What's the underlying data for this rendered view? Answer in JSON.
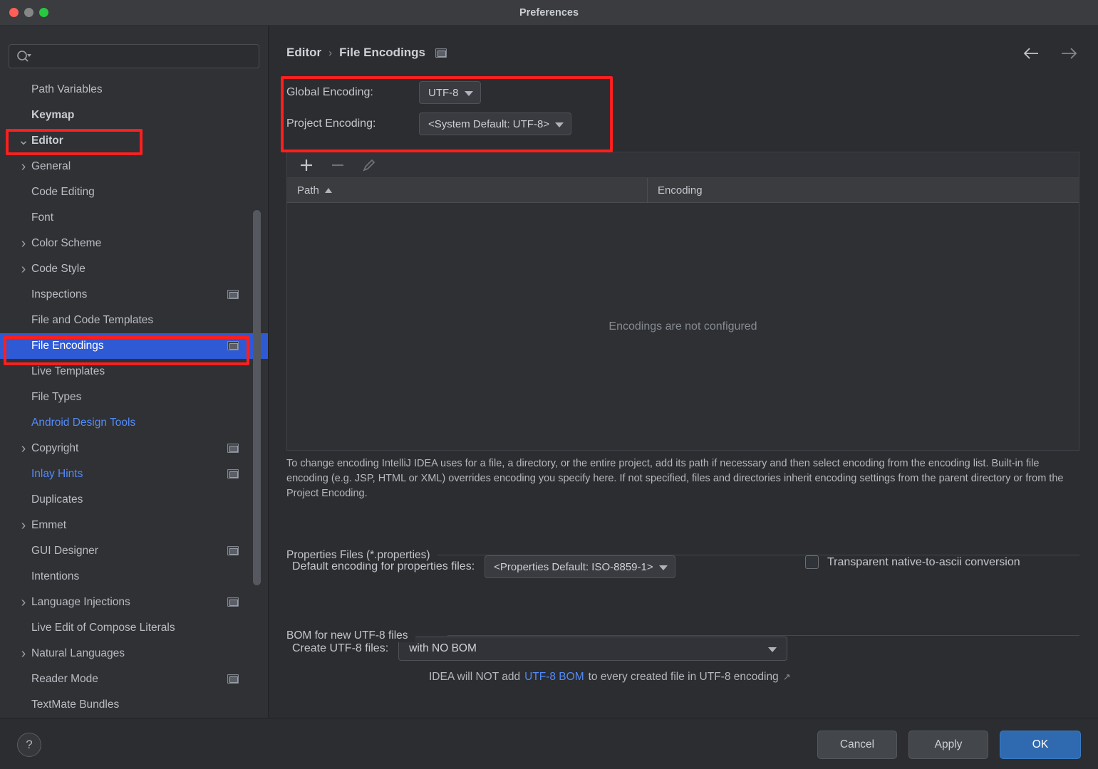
{
  "window": {
    "title": "Preferences",
    "traffic_lights": [
      "close",
      "minimize",
      "zoom"
    ]
  },
  "sidebar": {
    "search": {
      "value": "",
      "placeholder": "",
      "icon": "search-icon"
    },
    "items": [
      {
        "label": "Path Variables",
        "depth": 1,
        "chevron": "",
        "bold": false,
        "blue": false,
        "badge": false,
        "selected": false
      },
      {
        "label": "Keymap",
        "depth": 0,
        "chevron": "",
        "bold": true,
        "blue": false,
        "badge": false,
        "selected": false
      },
      {
        "label": "Editor",
        "depth": 0,
        "chevron": "v",
        "bold": true,
        "blue": false,
        "badge": false,
        "selected": false
      },
      {
        "label": "General",
        "depth": 1,
        "chevron": ">",
        "bold": false,
        "blue": false,
        "badge": false,
        "selected": false
      },
      {
        "label": "Code Editing",
        "depth": 1,
        "chevron": "",
        "bold": false,
        "blue": false,
        "badge": false,
        "selected": false
      },
      {
        "label": "Font",
        "depth": 1,
        "chevron": "",
        "bold": false,
        "blue": false,
        "badge": false,
        "selected": false
      },
      {
        "label": "Color Scheme",
        "depth": 1,
        "chevron": ">",
        "bold": false,
        "blue": false,
        "badge": false,
        "selected": false
      },
      {
        "label": "Code Style",
        "depth": 1,
        "chevron": ">",
        "bold": false,
        "blue": false,
        "badge": false,
        "selected": false
      },
      {
        "label": "Inspections",
        "depth": 1,
        "chevron": "",
        "bold": false,
        "blue": false,
        "badge": true,
        "selected": false
      },
      {
        "label": "File and Code Templates",
        "depth": 1,
        "chevron": "",
        "bold": false,
        "blue": false,
        "badge": false,
        "selected": false
      },
      {
        "label": "File Encodings",
        "depth": 1,
        "chevron": "",
        "bold": false,
        "blue": false,
        "badge": true,
        "selected": true
      },
      {
        "label": "Live Templates",
        "depth": 1,
        "chevron": "",
        "bold": false,
        "blue": false,
        "badge": false,
        "selected": false
      },
      {
        "label": "File Types",
        "depth": 1,
        "chevron": "",
        "bold": false,
        "blue": false,
        "badge": false,
        "selected": false
      },
      {
        "label": "Android Design Tools",
        "depth": 1,
        "chevron": "",
        "bold": false,
        "blue": true,
        "badge": false,
        "selected": false
      },
      {
        "label": "Copyright",
        "depth": 1,
        "chevron": ">",
        "bold": false,
        "blue": false,
        "badge": true,
        "selected": false
      },
      {
        "label": "Inlay Hints",
        "depth": 1,
        "chevron": "",
        "bold": false,
        "blue": true,
        "badge": true,
        "selected": false
      },
      {
        "label": "Duplicates",
        "depth": 1,
        "chevron": "",
        "bold": false,
        "blue": false,
        "badge": false,
        "selected": false
      },
      {
        "label": "Emmet",
        "depth": 1,
        "chevron": ">",
        "bold": false,
        "blue": false,
        "badge": false,
        "selected": false
      },
      {
        "label": "GUI Designer",
        "depth": 1,
        "chevron": "",
        "bold": false,
        "blue": false,
        "badge": true,
        "selected": false
      },
      {
        "label": "Intentions",
        "depth": 1,
        "chevron": "",
        "bold": false,
        "blue": false,
        "badge": false,
        "selected": false
      },
      {
        "label": "Language Injections",
        "depth": 1,
        "chevron": ">",
        "bold": false,
        "blue": false,
        "badge": true,
        "selected": false
      },
      {
        "label": "Live Edit of Compose Literals",
        "depth": 1,
        "chevron": "",
        "bold": false,
        "blue": false,
        "badge": false,
        "selected": false
      },
      {
        "label": "Natural Languages",
        "depth": 1,
        "chevron": ">",
        "bold": false,
        "blue": false,
        "badge": false,
        "selected": false
      },
      {
        "label": "Reader Mode",
        "depth": 1,
        "chevron": "",
        "bold": false,
        "blue": false,
        "badge": true,
        "selected": false
      },
      {
        "label": "TextMate Bundles",
        "depth": 1,
        "chevron": "",
        "bold": false,
        "blue": false,
        "badge": false,
        "selected": false
      }
    ]
  },
  "main": {
    "breadcrumb": {
      "parent": "Editor",
      "separator": "›",
      "current": "File Encodings"
    },
    "nav": {
      "back": "back-arrow",
      "forward": "forward-arrow"
    },
    "encoding": {
      "global_label": "Global Encoding:",
      "global_value": "UTF-8",
      "project_label": "Project Encoding:",
      "project_value": "<System Default: UTF-8>"
    },
    "table": {
      "toolbar": {
        "add": "+",
        "remove": "−",
        "edit": "pencil"
      },
      "columns": [
        "Path",
        "Encoding"
      ],
      "sort_column": "Path",
      "sort_direction": "asc",
      "rows": [],
      "empty_message": "Encodings are not configured"
    },
    "description": "To change encoding IntelliJ IDEA uses for a file, a directory, or the entire project, add its path if necessary and then select encoding from the encoding list. Built-in file encoding (e.g. JSP, HTML or XML) overrides encoding you specify here. If not specified, files and directories inherit encoding settings from the parent directory or from the Project Encoding.",
    "properties_section": {
      "title": "Properties Files (*.properties)",
      "default_encoding_label": "Default encoding for properties files:",
      "default_encoding_value": "<Properties Default: ISO-8859-1>",
      "checkbox_label": "Transparent native-to-ascii conversion",
      "checkbox_checked": false
    },
    "bom_section": {
      "title": "BOM for new UTF-8 files",
      "create_label": "Create UTF-8 files:",
      "create_value": "with NO BOM",
      "note_prefix": "IDEA will NOT add",
      "note_link": "UTF-8 BOM",
      "note_suffix": "to every created file in UTF-8 encoding",
      "note_external_icon": "↗"
    }
  },
  "footer": {
    "help": "?",
    "cancel": "Cancel",
    "apply": "Apply",
    "ok": "OK"
  },
  "annotations": {
    "highlight_color": "#ff1f1f",
    "boxes": [
      "editor-tree-item",
      "file-encodings-tree-item",
      "encoding-panel"
    ]
  },
  "colors": {
    "selection_blue": "#2f5ad6",
    "link_blue": "#548af7",
    "primary_button": "#2f6ab0",
    "window_bg": "#2b2d30",
    "sidebar_bg": "#2f3135"
  }
}
